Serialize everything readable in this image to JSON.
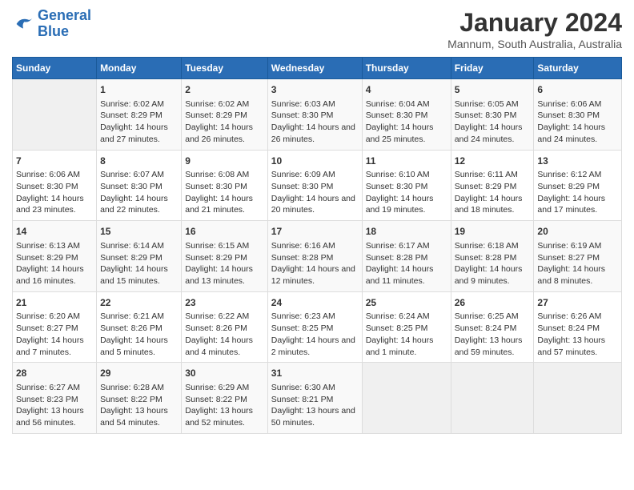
{
  "logo": {
    "line1": "General",
    "line2": "Blue"
  },
  "title": "January 2024",
  "subtitle": "Mannum, South Australia, Australia",
  "headers": [
    "Sunday",
    "Monday",
    "Tuesday",
    "Wednesday",
    "Thursday",
    "Friday",
    "Saturday"
  ],
  "weeks": [
    [
      {
        "day": "",
        "sunrise": "",
        "sunset": "",
        "daylight": ""
      },
      {
        "day": "1",
        "sunrise": "6:02 AM",
        "sunset": "8:29 PM",
        "daylight": "14 hours and 27 minutes."
      },
      {
        "day": "2",
        "sunrise": "6:02 AM",
        "sunset": "8:29 PM",
        "daylight": "14 hours and 26 minutes."
      },
      {
        "day": "3",
        "sunrise": "6:03 AM",
        "sunset": "8:30 PM",
        "daylight": "14 hours and 26 minutes."
      },
      {
        "day": "4",
        "sunrise": "6:04 AM",
        "sunset": "8:30 PM",
        "daylight": "14 hours and 25 minutes."
      },
      {
        "day": "5",
        "sunrise": "6:05 AM",
        "sunset": "8:30 PM",
        "daylight": "14 hours and 24 minutes."
      },
      {
        "day": "6",
        "sunrise": "6:06 AM",
        "sunset": "8:30 PM",
        "daylight": "14 hours and 24 minutes."
      }
    ],
    [
      {
        "day": "7",
        "sunrise": "6:06 AM",
        "sunset": "8:30 PM",
        "daylight": "14 hours and 23 minutes."
      },
      {
        "day": "8",
        "sunrise": "6:07 AM",
        "sunset": "8:30 PM",
        "daylight": "14 hours and 22 minutes."
      },
      {
        "day": "9",
        "sunrise": "6:08 AM",
        "sunset": "8:30 PM",
        "daylight": "14 hours and 21 minutes."
      },
      {
        "day": "10",
        "sunrise": "6:09 AM",
        "sunset": "8:30 PM",
        "daylight": "14 hours and 20 minutes."
      },
      {
        "day": "11",
        "sunrise": "6:10 AM",
        "sunset": "8:30 PM",
        "daylight": "14 hours and 19 minutes."
      },
      {
        "day": "12",
        "sunrise": "6:11 AM",
        "sunset": "8:29 PM",
        "daylight": "14 hours and 18 minutes."
      },
      {
        "day": "13",
        "sunrise": "6:12 AM",
        "sunset": "8:29 PM",
        "daylight": "14 hours and 17 minutes."
      }
    ],
    [
      {
        "day": "14",
        "sunrise": "6:13 AM",
        "sunset": "8:29 PM",
        "daylight": "14 hours and 16 minutes."
      },
      {
        "day": "15",
        "sunrise": "6:14 AM",
        "sunset": "8:29 PM",
        "daylight": "14 hours and 15 minutes."
      },
      {
        "day": "16",
        "sunrise": "6:15 AM",
        "sunset": "8:29 PM",
        "daylight": "14 hours and 13 minutes."
      },
      {
        "day": "17",
        "sunrise": "6:16 AM",
        "sunset": "8:28 PM",
        "daylight": "14 hours and 12 minutes."
      },
      {
        "day": "18",
        "sunrise": "6:17 AM",
        "sunset": "8:28 PM",
        "daylight": "14 hours and 11 minutes."
      },
      {
        "day": "19",
        "sunrise": "6:18 AM",
        "sunset": "8:28 PM",
        "daylight": "14 hours and 9 minutes."
      },
      {
        "day": "20",
        "sunrise": "6:19 AM",
        "sunset": "8:27 PM",
        "daylight": "14 hours and 8 minutes."
      }
    ],
    [
      {
        "day": "21",
        "sunrise": "6:20 AM",
        "sunset": "8:27 PM",
        "daylight": "14 hours and 7 minutes."
      },
      {
        "day": "22",
        "sunrise": "6:21 AM",
        "sunset": "8:26 PM",
        "daylight": "14 hours and 5 minutes."
      },
      {
        "day": "23",
        "sunrise": "6:22 AM",
        "sunset": "8:26 PM",
        "daylight": "14 hours and 4 minutes."
      },
      {
        "day": "24",
        "sunrise": "6:23 AM",
        "sunset": "8:25 PM",
        "daylight": "14 hours and 2 minutes."
      },
      {
        "day": "25",
        "sunrise": "6:24 AM",
        "sunset": "8:25 PM",
        "daylight": "14 hours and 1 minute."
      },
      {
        "day": "26",
        "sunrise": "6:25 AM",
        "sunset": "8:24 PM",
        "daylight": "13 hours and 59 minutes."
      },
      {
        "day": "27",
        "sunrise": "6:26 AM",
        "sunset": "8:24 PM",
        "daylight": "13 hours and 57 minutes."
      }
    ],
    [
      {
        "day": "28",
        "sunrise": "6:27 AM",
        "sunset": "8:23 PM",
        "daylight": "13 hours and 56 minutes."
      },
      {
        "day": "29",
        "sunrise": "6:28 AM",
        "sunset": "8:22 PM",
        "daylight": "13 hours and 54 minutes."
      },
      {
        "day": "30",
        "sunrise": "6:29 AM",
        "sunset": "8:22 PM",
        "daylight": "13 hours and 52 minutes."
      },
      {
        "day": "31",
        "sunrise": "6:30 AM",
        "sunset": "8:21 PM",
        "daylight": "13 hours and 50 minutes."
      },
      {
        "day": "",
        "sunrise": "",
        "sunset": "",
        "daylight": ""
      },
      {
        "day": "",
        "sunrise": "",
        "sunset": "",
        "daylight": ""
      },
      {
        "day": "",
        "sunrise": "",
        "sunset": "",
        "daylight": ""
      }
    ]
  ]
}
